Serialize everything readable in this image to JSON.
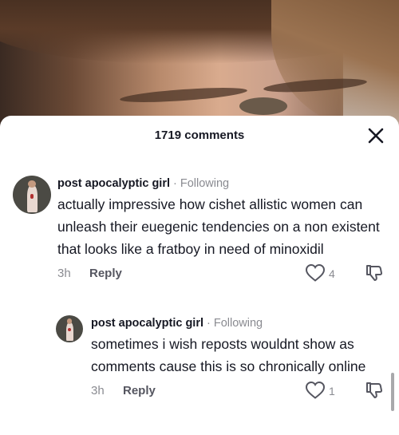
{
  "header": {
    "comment_count": "1719 comments"
  },
  "comments": [
    {
      "username": "post apocalyptic girl",
      "separator": "·",
      "status": "Following",
      "text": "actually impressive how cishet allistic women can unleash their euegenic tendencies on a non existent that looks like a fratboy in need of minoxidil",
      "time": "3h",
      "reply_label": "Reply",
      "likes": "4"
    },
    {
      "username": "post apocalyptic girl",
      "separator": "·",
      "status": "Following",
      "text": "sometimes i wish reposts wouldnt show as comments cause this is so chronically online",
      "time": "3h",
      "reply_label": "Reply",
      "likes": "1"
    }
  ],
  "icons": {
    "close": "close-icon",
    "like": "heart-outline-icon",
    "dislike": "thumbs-down-icon"
  }
}
